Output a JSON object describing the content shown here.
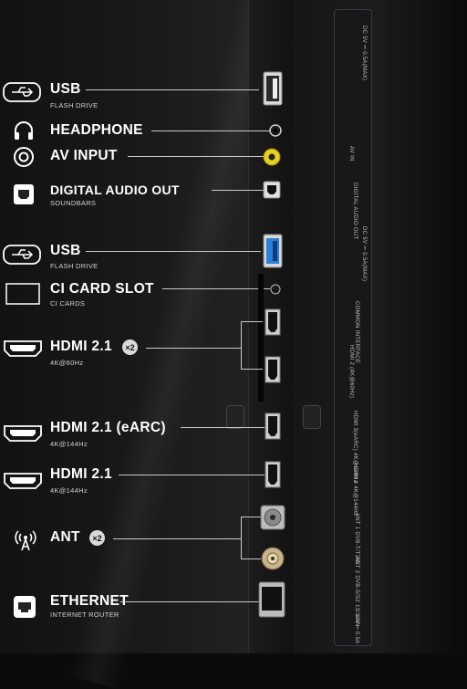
{
  "ports": [
    {
      "key": "usb1",
      "name": "USB",
      "sub": "FLASH DRIVE",
      "icon": "usb-icon"
    },
    {
      "key": "headphone",
      "name": "HEADPHONE",
      "icon": "headphone-icon"
    },
    {
      "key": "av",
      "name": "AV INPUT",
      "icon": "av-input-icon"
    },
    {
      "key": "optical",
      "name": "DIGITAL AUDIO OUT",
      "sub": "SOUNDBARS",
      "icon": "optical-icon"
    },
    {
      "key": "usb2",
      "name": "USB",
      "sub": "FLASH DRIVE",
      "icon": "usb-icon"
    },
    {
      "key": "ci",
      "name": "CI CARD SLOT",
      "sub": "CI CARDS",
      "icon": "ci-card-icon"
    },
    {
      "key": "hdmi1",
      "name": "HDMI 2.1",
      "sub": "4K@60Hz",
      "badge": "×2",
      "icon": "hdmi-icon"
    },
    {
      "key": "hdmi2",
      "name": "HDMI 2.1 (eARC)",
      "sub": "4K@144Hz",
      "icon": "hdmi-icon"
    },
    {
      "key": "hdmi3",
      "name": "HDMI 2.1",
      "sub": "4K@144Hz",
      "icon": "hdmi-icon"
    },
    {
      "key": "ant",
      "name": "ANT",
      "badge": "×2",
      "icon": "antenna-icon"
    },
    {
      "key": "eth",
      "name": "ETHERNET",
      "sub": "INTERNET ROUTER",
      "icon": "ethernet-icon"
    }
  ],
  "panel_labels": {
    "usb1": "DC 5V ⎓ 0.5A(MAX)",
    "av": "AV IN",
    "optical": "DIGITAL AUDIO OUT",
    "usb2": "DC 5V ⎓ 0.5A(MAX)",
    "ci": "COMMON INTERFACE",
    "hdmi1": "HDMI 2 (4K@60Hz)",
    "hdmi2": "HDMI 3(eARC) 4K@144Hz",
    "hdmi3": "HDMI 4 4K@144Hz",
    "ant1": "ANT 1 DVB-T/T2/C",
    "ant2": "ANT 2 DVB-S/S2 13/18V ⎓ 0.5A",
    "lan": "LAN"
  },
  "colors": {
    "background": "#0b0b0c",
    "text": "#ffffff",
    "line": "#c9c9c9",
    "usb3_blue": "#2a7fd8",
    "av_yellow": "#e8d020"
  }
}
